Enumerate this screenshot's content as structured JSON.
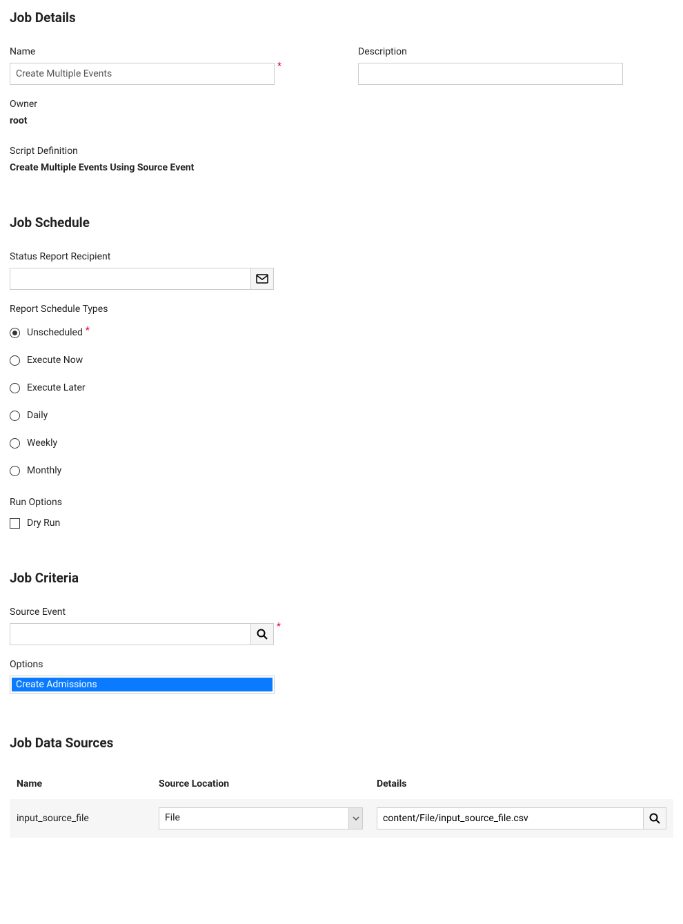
{
  "jobDetails": {
    "title": "Job Details",
    "nameLabel": "Name",
    "nameValue": "Create Multiple Events",
    "descriptionLabel": "Description",
    "descriptionValue": "",
    "ownerLabel": "Owner",
    "ownerValue": "root",
    "scriptDefLabel": "Script Definition",
    "scriptDefValue": "Create Multiple Events Using Source Event"
  },
  "jobSchedule": {
    "title": "Job Schedule",
    "statusReportLabel": "Status Report Recipient",
    "statusReportValue": "",
    "scheduleTypesLabel": "Report Schedule Types",
    "scheduleOptions": [
      {
        "label": "Unscheduled",
        "checked": true,
        "required": true
      },
      {
        "label": "Execute Now",
        "checked": false,
        "required": false
      },
      {
        "label": "Execute Later",
        "checked": false,
        "required": false
      },
      {
        "label": "Daily",
        "checked": false,
        "required": false
      },
      {
        "label": "Weekly",
        "checked": false,
        "required": false
      },
      {
        "label": "Monthly",
        "checked": false,
        "required": false
      }
    ],
    "runOptionsLabel": "Run Options",
    "dryRunLabel": "Dry Run",
    "dryRunChecked": false
  },
  "jobCriteria": {
    "title": "Job Criteria",
    "sourceEventLabel": "Source Event",
    "sourceEventValue": "",
    "optionsLabel": "Options",
    "optionsSelected": "Create Admissions"
  },
  "jobDataSources": {
    "title": "Job Data Sources",
    "headers": {
      "name": "Name",
      "source": "Source Location",
      "details": "Details"
    },
    "rows": [
      {
        "name": "input_source_file",
        "source": "File",
        "details": "content/File/input_source_file.csv"
      }
    ],
    "requiredMark": "*"
  },
  "requiredMark": "*"
}
